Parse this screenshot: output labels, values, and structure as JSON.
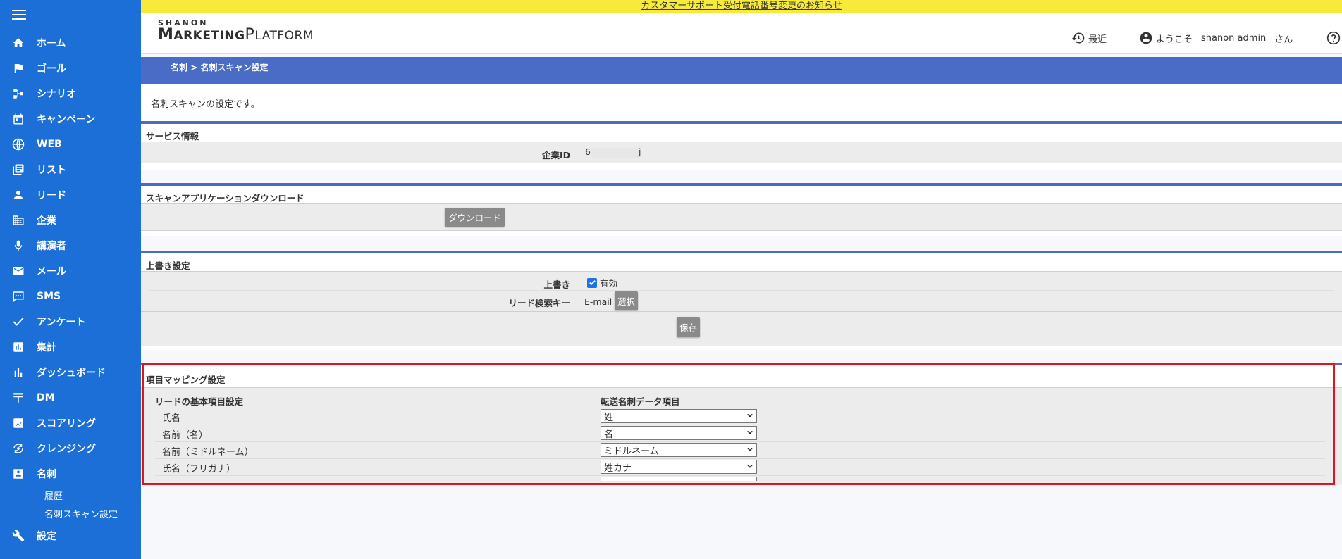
{
  "notice": "カスタマーサポート受付電話番号変更のお知らせ",
  "logo": {
    "small": "SHANON",
    "big_1": "M",
    "big_2": "ARKETING",
    "big_3": "P",
    "big_4": "LATFORM"
  },
  "header": {
    "recent": "最近",
    "welcome": "ようこそ",
    "user": "shanon admin",
    "suffix": "さん"
  },
  "nav": [
    {
      "label": "ホーム",
      "icon": "home-icon"
    },
    {
      "label": "ゴール",
      "icon": "flag-icon"
    },
    {
      "label": "シナリオ",
      "icon": "scenario-icon"
    },
    {
      "label": "キャンペーン",
      "icon": "calendar-icon"
    },
    {
      "label": "WEB",
      "icon": "globe-icon"
    },
    {
      "label": "リスト",
      "icon": "list-icon"
    },
    {
      "label": "リード",
      "icon": "person-icon"
    },
    {
      "label": "企業",
      "icon": "building-icon"
    },
    {
      "label": "講演者",
      "icon": "mic-icon"
    },
    {
      "label": "メール",
      "icon": "mail-icon"
    },
    {
      "label": "SMS",
      "icon": "chat-icon"
    },
    {
      "label": "アンケート",
      "icon": "check-icon"
    },
    {
      "label": "集計",
      "icon": "chart-icon"
    },
    {
      "label": "ダッシュボード",
      "icon": "bar-chart-icon"
    },
    {
      "label": "DM",
      "icon": "post-icon"
    },
    {
      "label": "スコアリング",
      "icon": "score-icon"
    },
    {
      "label": "クレンジング",
      "icon": "cleansing-icon"
    },
    {
      "label": "名刺",
      "icon": "card-icon"
    }
  ],
  "subnav": [
    "履歴",
    "名刺スキャン設定"
  ],
  "settings_label": "設定",
  "breadcrumb": {
    "parent": "名刺",
    "sep": " > ",
    "current": "名刺スキャン設定"
  },
  "description": "名刺スキャンの設定です。",
  "service": {
    "title": "サービス情報",
    "company_id_label": "企業ID",
    "company_id_prefix": "6",
    "company_id_suffix": "j"
  },
  "download": {
    "title": "スキャンアプリケーションダウンロード",
    "button": "ダウンロード"
  },
  "overwrite": {
    "title": "上書き設定",
    "label": "上書き",
    "checkbox_label": "有効",
    "search_key_label": "リード検索キー",
    "search_key_value": "E-mail",
    "select_button": "選択",
    "save_button": "保存"
  },
  "mapping": {
    "title": "項目マッピング設定",
    "col_left": "リードの基本項目設定",
    "col_right": "転送名刺データ項目",
    "rows": [
      {
        "label": "氏名",
        "value": "姓"
      },
      {
        "label": "名前（名）",
        "value": "名"
      },
      {
        "label": "名前（ミドルネーム）",
        "value": "ミドルネーム"
      },
      {
        "label": "氏名（フリガナ）",
        "value": "姓カナ"
      }
    ]
  }
}
